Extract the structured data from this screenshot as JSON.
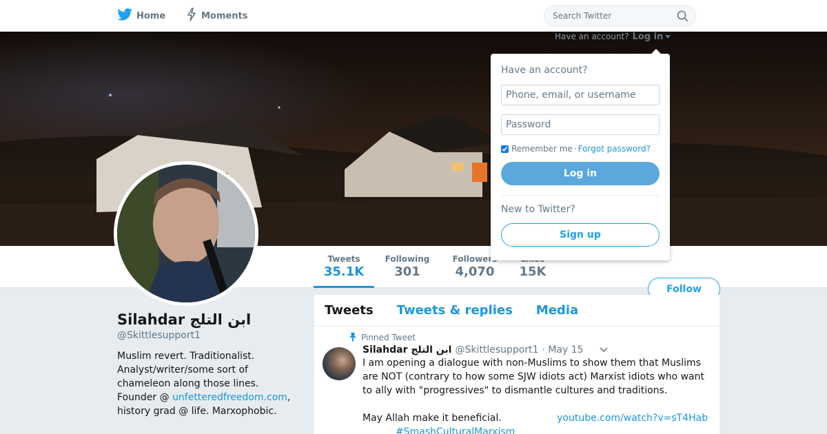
{
  "nav": {
    "home_label": "Home",
    "moments_label": "Moments",
    "search_placeholder": "Search Twitter",
    "have_account": "Have an account?",
    "login_link": "Log in"
  },
  "colors": {
    "brand": "#1da1f2",
    "link": "#1b95e0",
    "muted": "#657786"
  },
  "profile": {
    "name": "Silahdar ابن التلج",
    "handle": "@Skittlesupport1",
    "bio_line1": "Muslim revert. Traditionalist. Analyst/writer/some sort of chameleon along those lines. Founder @",
    "bio_link": "unfetteredfreedom.com",
    "bio_line2": ", history grad @ life. Marxophobic.",
    "follow_label": "Follow"
  },
  "stats": [
    {
      "label": "Tweets",
      "value": "35.1K"
    },
    {
      "label": "Following",
      "value": "301"
    },
    {
      "label": "Followers",
      "value": "4,070"
    },
    {
      "label": "Likes",
      "value": "15K"
    }
  ],
  "timeline": {
    "tabs": [
      "Tweets",
      "Tweets & replies",
      "Media"
    ],
    "pinned_label": "Pinned Tweet",
    "tweet": {
      "name": "Silahdar ابن التلج",
      "handle": "@Skittlesupport1",
      "date": "· May 15",
      "text1": "I am opening a dialogue with non-Muslims to show them that Muslims are NOT (contrary to how some SJW idiots act) Marxist idiots who want to ally with \"progressives\" to dismantle cultures and traditions.",
      "text2": "May Allah make it beneficial.",
      "link": "youtube.com/watch?v=sT4Hab",
      "hashtag": "#SmashCulturalMarxism"
    }
  },
  "login_dropdown": {
    "heading": "Have an account?",
    "username_placeholder": "Phone, email, or username",
    "password_placeholder": "Password",
    "remember_label": "Remember me",
    "separator": "·",
    "forgot_label": "Forgot password?",
    "login_button": "Log in",
    "new_heading": "New to Twitter?",
    "signup_button": "Sign up"
  }
}
